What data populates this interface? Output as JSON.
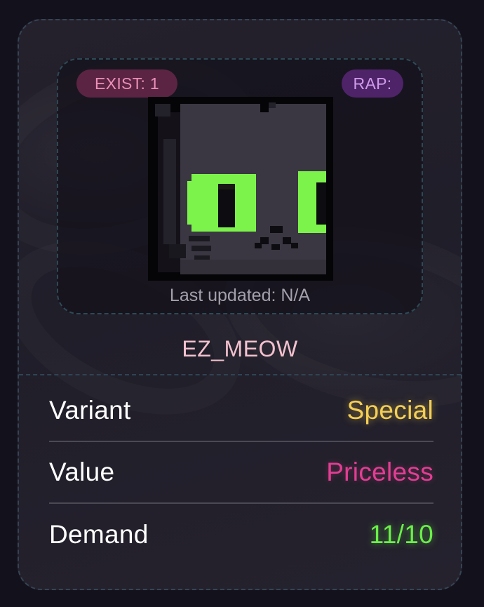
{
  "card": {
    "exist_badge": "EXIST: 1",
    "rap_badge": "RAP:",
    "image_alt": "pixel-art black cat with green eyes",
    "last_updated": "Last updated: N/A",
    "item_name": "EZ_MEOW"
  },
  "stats": [
    {
      "label": "Variant",
      "value": "Special",
      "color": "#f4cf55"
    },
    {
      "label": "Value",
      "value": "Priceless",
      "color": "#e13e93"
    },
    {
      "label": "Demand",
      "value": "11/10",
      "color": "#6aef49"
    }
  ],
  "colors": {
    "background": "#13111c",
    "card": "#221f2a",
    "dashed_border": "#344554",
    "exist_badge_bg": "#5b2443",
    "rap_badge_bg": "#4e2368",
    "item_name": "#f3c1ce"
  }
}
